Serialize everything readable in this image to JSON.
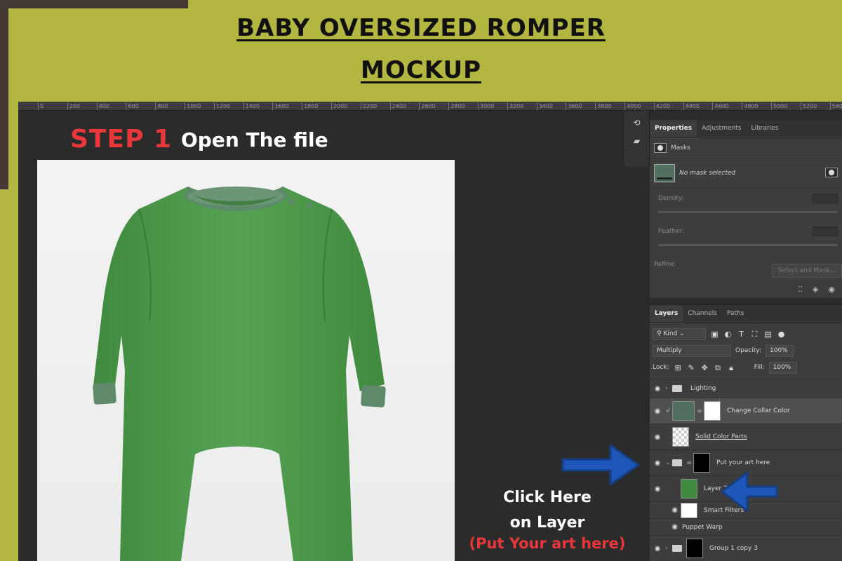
{
  "header": {
    "title_line1": "BABY OVERSIZED ROMPER",
    "title_line2": "MOCKUP"
  },
  "ruler": {
    "ticks": [
      "0",
      "200",
      "400",
      "600",
      "800",
      "1000",
      "1200",
      "1400",
      "1600",
      "1800",
      "2000",
      "2200",
      "2400",
      "2600",
      "2800",
      "3000",
      "3200",
      "3400",
      "3600",
      "3800",
      "4000",
      "4200",
      "4400",
      "4600",
      "4800",
      "5000",
      "5200",
      "540"
    ]
  },
  "step": {
    "label": "STEP 1",
    "subtitle": "Open The file"
  },
  "properties_panel": {
    "tabs": [
      "Properties",
      "Adjustments",
      "Libraries"
    ],
    "active_tab": "Properties",
    "section_label": "Masks",
    "no_mask_text": "No mask selected",
    "density_label": "Density:",
    "feather_label": "Feather:",
    "refine_label": "Refine:",
    "select_mask_button": "Select and Mask..."
  },
  "layers_panel": {
    "tabs": [
      "Layers",
      "Channels",
      "Paths"
    ],
    "active_tab": "Layers",
    "kind_filter": "Kind",
    "blend_mode": "Multiply",
    "opacity_label": "Opacity:",
    "opacity_value": "100%",
    "lock_label": "Lock:",
    "fill_label": "Fill:",
    "fill_value": "100%",
    "layers": [
      {
        "name": "Lighting",
        "type": "group"
      },
      {
        "name": "Change Collar Color",
        "type": "adjustment"
      },
      {
        "name": "Solid Color Parts",
        "type": "layer"
      },
      {
        "name": "Put your art here",
        "type": "group"
      },
      {
        "name": "Layer 2",
        "type": "smart-object"
      },
      {
        "name": "Smart Filters",
        "type": "filter"
      },
      {
        "name": "Puppet Warp",
        "type": "filter-item"
      },
      {
        "name": "Group 1 copy 3",
        "type": "group"
      }
    ]
  },
  "callout": {
    "line1": "Click Here",
    "line2": "on Layer",
    "line3": "(Put Your art here)"
  },
  "colors": {
    "background": "#b3b641",
    "accent_red": "#e8373a",
    "arrow_blue": "#1f57b8",
    "romper_green": "#4c9a4b"
  }
}
